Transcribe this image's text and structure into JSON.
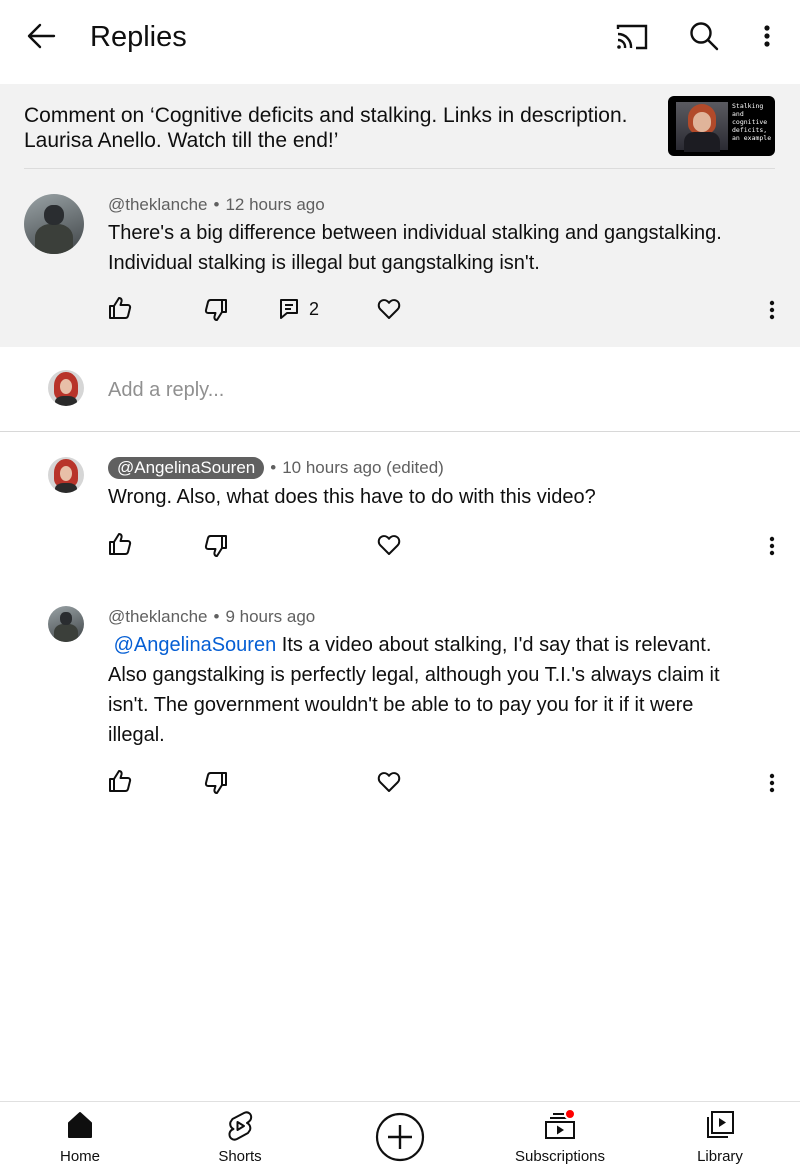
{
  "header": {
    "title": "Replies",
    "icons": [
      "arrow-left-icon",
      "cast-icon",
      "search-icon",
      "more-vertical-icon"
    ]
  },
  "context": {
    "video_comment_title": "Comment on ‘Cognitive deficits and stalking. Links in description. Laurisa Anello. Watch till the end!’",
    "thumbnail_text": "Stalking and cognitive deficits, an example"
  },
  "parent_comment": {
    "author": "@theklanche",
    "time": "12 hours ago",
    "text": "There's a big difference between individual stalking and gangstalking. Individual stalking is illegal but gangstalking isn't.",
    "reply_count": "2"
  },
  "reply_box": {
    "placeholder": "Add a reply..."
  },
  "replies": [
    {
      "author": "@AngelinaSouren",
      "time": "10 hours ago (edited)",
      "text": "Wrong. Also, what does this have to do with this video?"
    },
    {
      "author": "@theklanche",
      "time": "9 hours ago",
      "mention": "@AngelinaSouren",
      "text": " Its a video about stalking, I'd say that is relevant. Also gangstalking is perfectly legal, although you T.I.'s always claim it isn't. The government wouldn't be able to to pay you for it if it were illegal."
    }
  ],
  "bottom_nav": {
    "home": "Home",
    "shorts": "Shorts",
    "subscriptions": "Subscriptions",
    "library": "Library"
  },
  "colors": {
    "mention": "#065fd4",
    "notification_dot": "#ff0000",
    "context_bg": "#f2f2f2"
  }
}
